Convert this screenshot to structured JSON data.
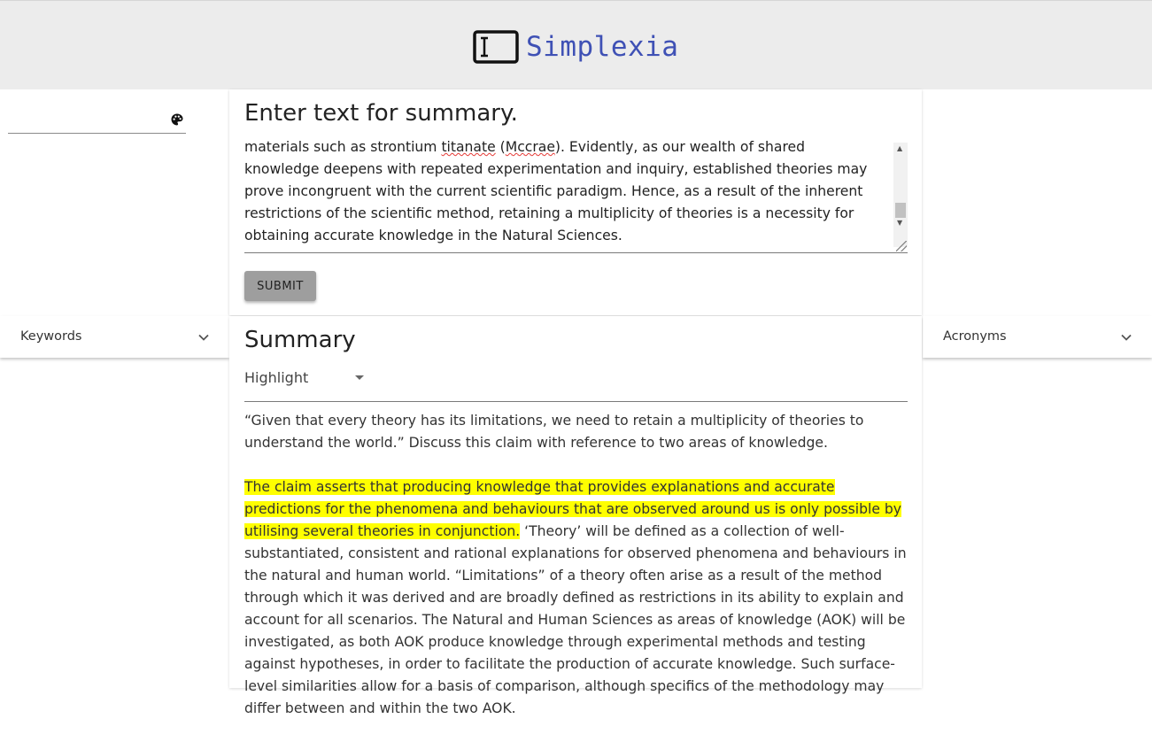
{
  "header": {
    "app_name": "Simplexia",
    "logo_icon": "text-cursor-icon",
    "brand_color": "#3f51b5"
  },
  "search": {
    "value": "",
    "placeholder": "",
    "icon": "palette-icon"
  },
  "input_card": {
    "title": "Enter text for summary.",
    "textarea_line1_pre": "materials such as strontium ",
    "textarea_spell1": "titanate",
    "textarea_line1_mid": " (",
    "textarea_spell2": "Mccrae",
    "textarea_line1_post": "). Evidently, as our wealth of shared knowledge deepens with repeated experimentation and inquiry, established theories may prove incongruent with the current scientific paradigm. Hence, as a result of the inherent restrictions of the scientific method, retaining a multiplicity of theories is a necessity for obtaining accurate knowledge in the Natural Sciences.",
    "submit_label": "SUBMIT"
  },
  "panels": {
    "left_label": "Keywords",
    "right_label": "Acronyms"
  },
  "summary": {
    "title": "Summary",
    "mode_selected": "Highlight",
    "highlight_color": "#ffff00",
    "paragraph1": "“Given that every theory has its limitations, we need to retain a multiplicity of theories to understand the world.” Discuss this claim with reference to two areas of knowledge.",
    "paragraph2_highlighted": "The claim asserts that producing knowledge that provides explanations and accurate predictions for the phenomena and behaviours that are observed around us is only possible by utilising several theories in conjunction.",
    "paragraph2_rest": " ‘Theory’ will be defined as a collection of well-substantiated, consistent and rational explanations for observed phenomena and behaviours in the natural and human world. “Limitations” of a theory often arise as a result of the method through which it was derived and are broadly defined as restrictions in its ability to explain and account for all scenarios. The Natural and Human Sciences as areas of knowledge (AOK) will be investigated, as both AOK produce knowledge through experimental methods and testing against hypotheses, in order to facilitate the production of accurate knowledge. Such surface-level similarities allow for a basis of comparison, although specifics of the methodology may differ between and within the two AOK."
  }
}
